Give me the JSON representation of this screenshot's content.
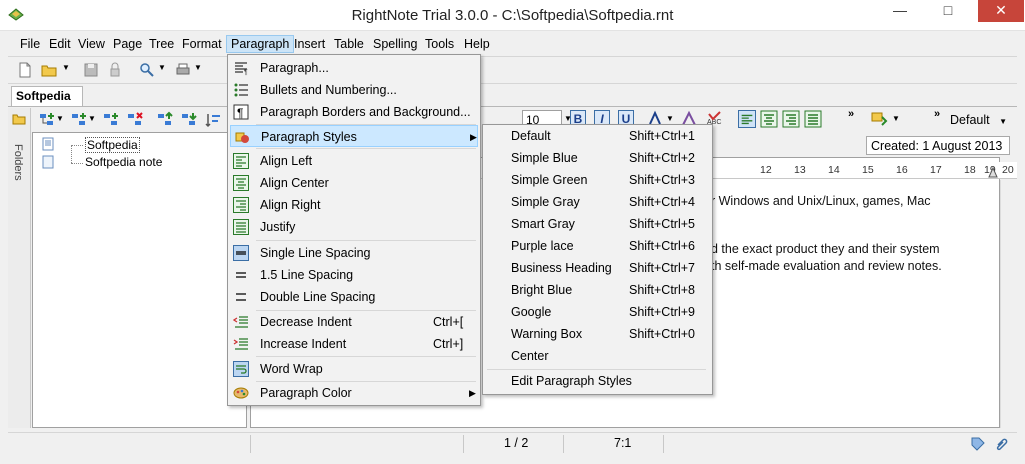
{
  "window": {
    "title": "RightNote Trial 3.0.0 - C:\\Softpedia\\Softpedia.rnt"
  },
  "window_controls": {
    "minimize": "—",
    "maximize": "□",
    "close": "✕"
  },
  "menubar": [
    "File",
    "Edit",
    "View",
    "Page",
    "Tree",
    "Format",
    "Paragraph",
    "Insert",
    "Table",
    "Spelling",
    "Tools",
    "Help"
  ],
  "tabs": [
    {
      "label": "Softpedia"
    }
  ],
  "folders_label": "Folders",
  "tree": {
    "items": [
      "Softpedia",
      "Softpedia note"
    ]
  },
  "editor": {
    "font_size": "10",
    "style_dropdown": "Default",
    "created": "Created: 1 August 2013",
    "ruler_numbers": [
      "12",
      "13",
      "14",
      "15",
      "16",
      "17",
      "18",
      "19",
      "20"
    ],
    "lines": [
      "r Windows and Unix/Linux, games, Mac",
      "d the exact product they and their system",
      "th self-made evaluation and review notes."
    ]
  },
  "statusbar": {
    "page": "1 / 2",
    "position": "7:1"
  },
  "paragraph_menu": {
    "items": [
      {
        "label": "Paragraph...",
        "icon": "paragraph-icon"
      },
      {
        "label": "Bullets and Numbering...",
        "icon": "bullets-icon"
      },
      {
        "label": "Paragraph Borders and Background...",
        "icon": "pilcrow-icon"
      },
      {
        "label": "Paragraph Styles",
        "icon": "styles-icon",
        "submenu": true
      },
      {
        "label": "Align Left",
        "icon": "align-left-icon"
      },
      {
        "label": "Align Center",
        "icon": "align-center-icon"
      },
      {
        "label": "Align Right",
        "icon": "align-right-icon"
      },
      {
        "label": "Justify",
        "icon": "justify-icon"
      },
      {
        "label": "Single Line Spacing",
        "icon": "single-spacing-icon"
      },
      {
        "label": "1.5 Line Spacing",
        "icon": "one-half-spacing-icon"
      },
      {
        "label": "Double Line Spacing",
        "icon": "double-spacing-icon"
      },
      {
        "label": "Decrease Indent",
        "shortcut": "Ctrl+[",
        "icon": "decrease-indent-icon"
      },
      {
        "label": "Increase Indent",
        "shortcut": "Ctrl+]",
        "icon": "increase-indent-icon"
      },
      {
        "label": "Word Wrap",
        "icon": "word-wrap-icon"
      },
      {
        "label": "Paragraph Color",
        "icon": "palette-icon",
        "submenu": true
      }
    ]
  },
  "styles_submenu": {
    "items": [
      {
        "label": "Default",
        "shortcut": "Shift+Ctrl+1"
      },
      {
        "label": "Simple Blue",
        "shortcut": "Shift+Ctrl+2"
      },
      {
        "label": "Simple Green",
        "shortcut": "Shift+Ctrl+3"
      },
      {
        "label": "Simple Gray",
        "shortcut": "Shift+Ctrl+4"
      },
      {
        "label": "Smart Gray",
        "shortcut": "Shift+Ctrl+5"
      },
      {
        "label": "Purple lace",
        "shortcut": "Shift+Ctrl+6"
      },
      {
        "label": "Business Heading",
        "shortcut": "Shift+Ctrl+7"
      },
      {
        "label": "Bright Blue",
        "shortcut": "Shift+Ctrl+8"
      },
      {
        "label": "Google",
        "shortcut": "Shift+Ctrl+9"
      },
      {
        "label": "Warning Box",
        "shortcut": "Shift+Ctrl+0"
      },
      {
        "label": "Center",
        "shortcut": ""
      },
      {
        "label": "Edit Paragraph Styles",
        "shortcut": ""
      }
    ]
  },
  "colors": {
    "menu_highlight": "#cce8ff",
    "accent": "#3c8c3c"
  }
}
